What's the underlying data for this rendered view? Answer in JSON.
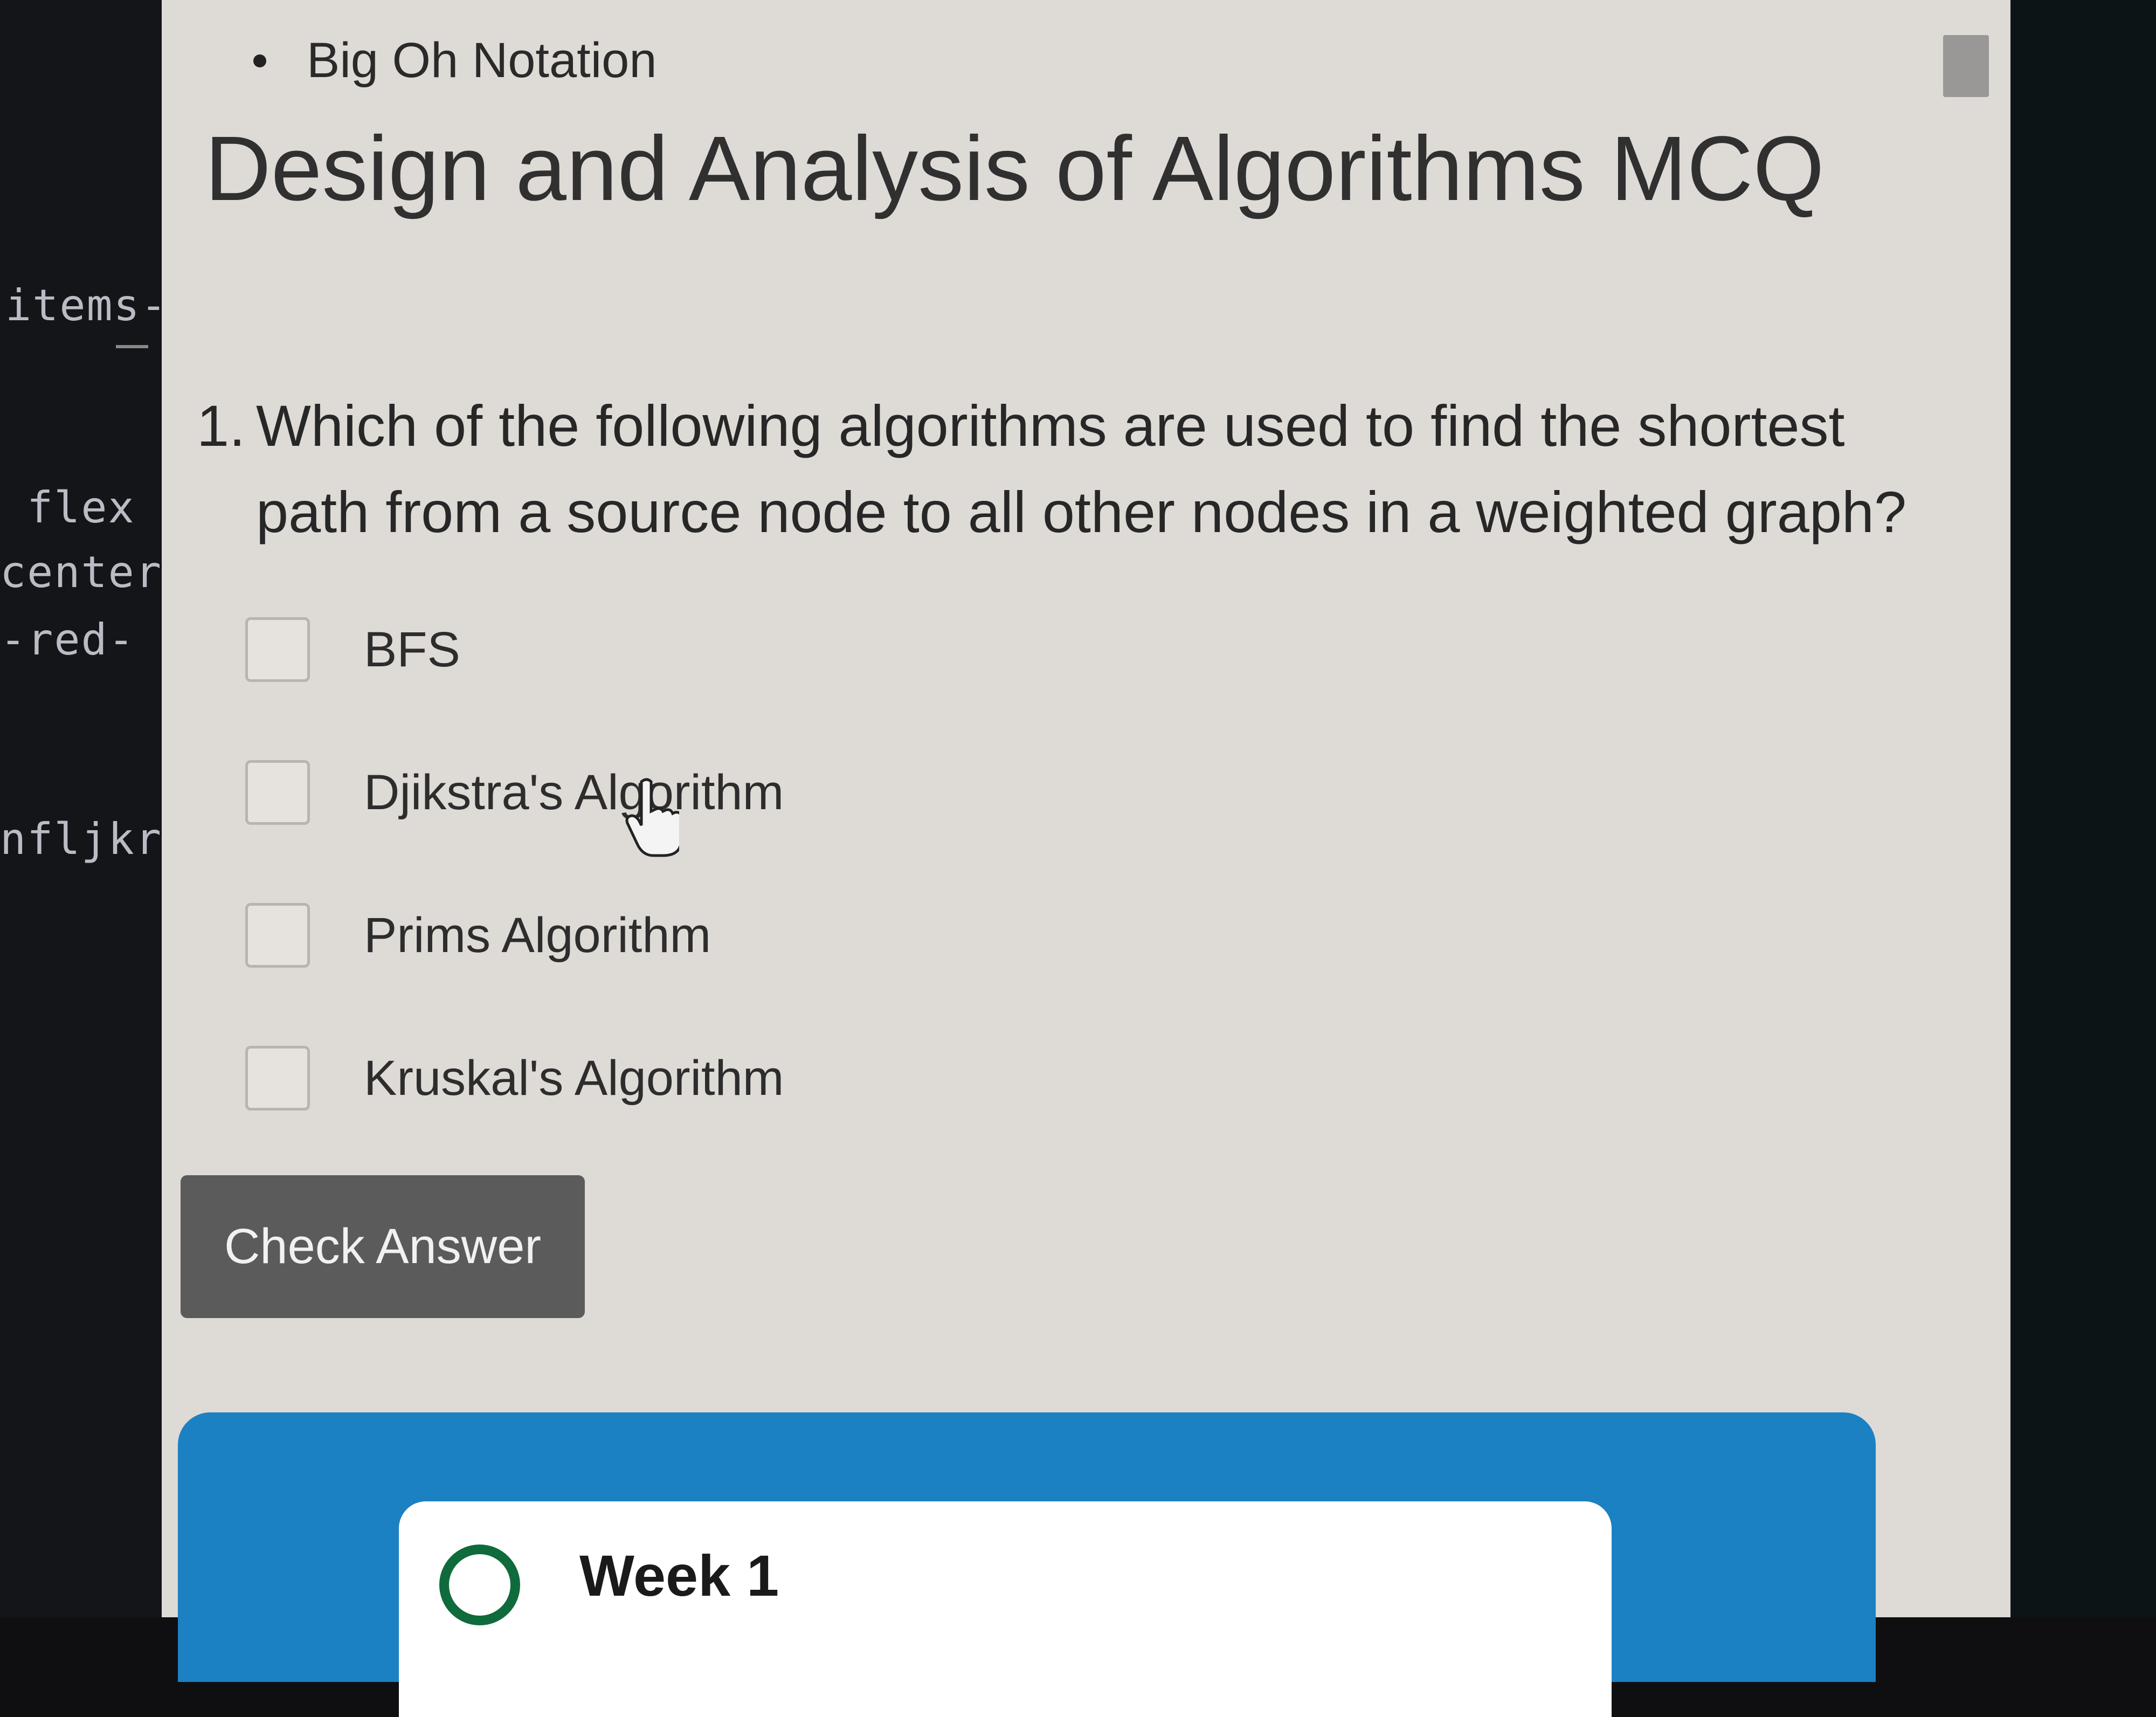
{
  "code_strip": {
    "tokens": [
      "items-",
      "flex",
      "center",
      "-red-",
      "nfljkr"
    ]
  },
  "nav": {
    "bullet_item": "Big Oh Notation"
  },
  "page": {
    "title": "Design and Analysis of Algorithms MCQ"
  },
  "question": {
    "number": "1.",
    "text_line1": "Which of the following algorithms are used to find the shortest",
    "text_line2": "path from a source node to all other nodes in a weighted graph?",
    "options": [
      {
        "label": "BFS",
        "checked": false
      },
      {
        "label": "Djikstra's Algorithm",
        "checked": false
      },
      {
        "label": "Prims Algorithm",
        "checked": false
      },
      {
        "label": "Kruskal's Algorithm",
        "checked": false
      }
    ]
  },
  "actions": {
    "check_answer_label": "Check Answer"
  },
  "weeks": {
    "first_label": "Week 1"
  },
  "colors": {
    "page_bg": "#dedad6",
    "button_bg": "#5b5b5b",
    "banner_blue": "#1b81c2",
    "week_circle": "#0f6b3b"
  }
}
